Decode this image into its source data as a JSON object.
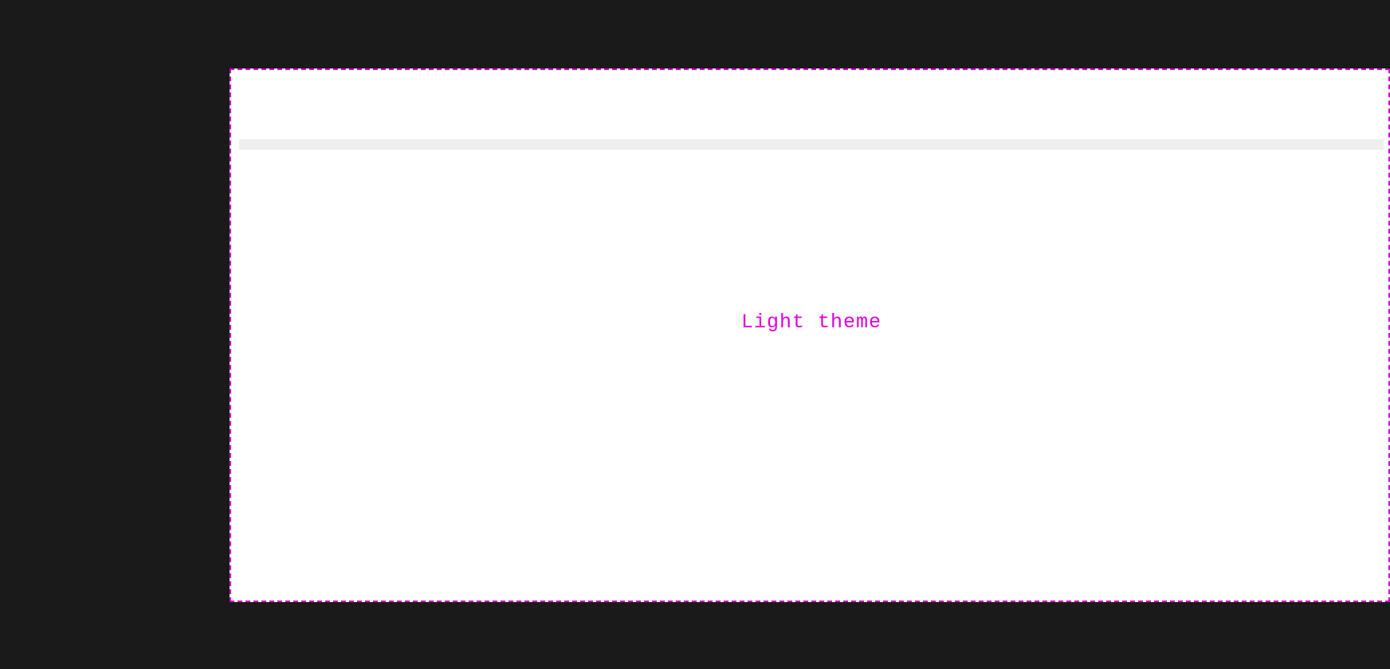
{
  "panel": {
    "theme_label": "Light theme"
  },
  "colors": {
    "background": "#1a1a1a",
    "frame_border": "#d400d4",
    "text": "#e000e0",
    "panel_bg": "#ffffff",
    "separator": "#eeeeee"
  }
}
